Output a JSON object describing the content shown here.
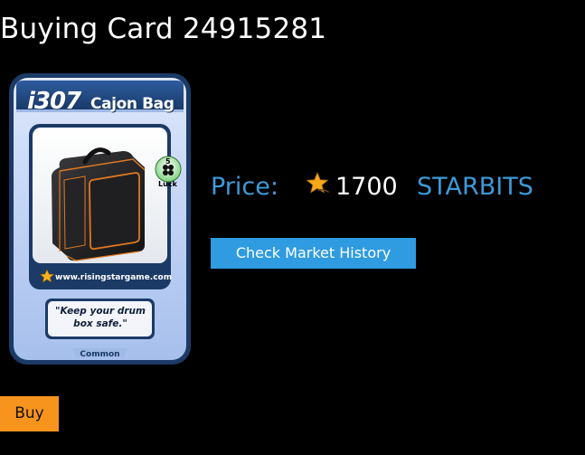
{
  "page": {
    "title": "Buying Card 24915281"
  },
  "card": {
    "number": "i307",
    "name": "Cajon Bag",
    "luck_value": "5",
    "luck_label": "Luck",
    "website": "www.risingstargame.com",
    "quote": "\"Keep your drum box safe.\"",
    "rarity": "Common",
    "image": "cajon-bag-illustration",
    "frame_color": "#1b3a66",
    "card_color": "#b9cdf2"
  },
  "price": {
    "label": "Price:",
    "icon": "star-icon",
    "amount": "1700",
    "currency": "STARBITS",
    "accent_color": "#3e9ad8"
  },
  "actions": {
    "history_label": "Check Market History",
    "buy_label": "Buy",
    "history_color": "#2f9be0",
    "buy_color": "#f7941d"
  }
}
